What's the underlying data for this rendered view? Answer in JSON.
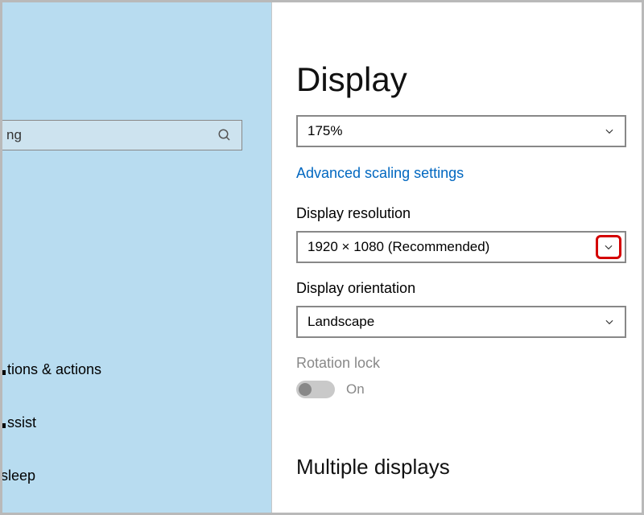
{
  "sidebar": {
    "search_value": "ng",
    "items": [
      "tions & actions",
      "ssist",
      "sleep"
    ]
  },
  "main": {
    "title": "Display",
    "scale": {
      "value": "175%"
    },
    "advanced_link": "Advanced scaling settings",
    "resolution": {
      "label": "Display resolution",
      "value": "1920 × 1080 (Recommended)"
    },
    "orientation": {
      "label": "Display orientation",
      "value": "Landscape"
    },
    "rotation": {
      "label": "Rotation lock",
      "state_label": "On"
    },
    "multiple_displays": "Multiple displays"
  }
}
